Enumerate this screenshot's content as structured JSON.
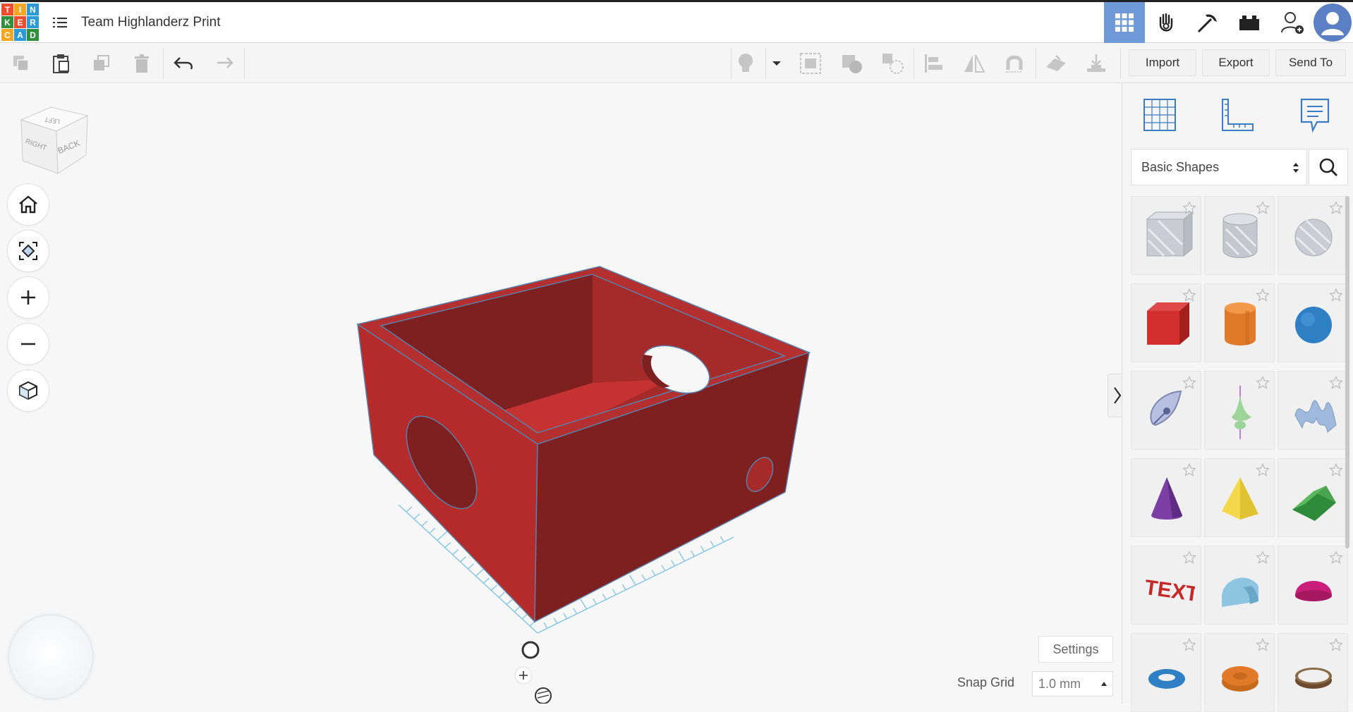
{
  "app": {
    "title": "Team Highlanderz Print",
    "logo_letters": [
      "T",
      "I",
      "N",
      "K",
      "E",
      "R",
      "C",
      "A",
      "D"
    ],
    "logo_colors": [
      "#e94f2e",
      "#f5a623",
      "#2a9bd7",
      "#2f8f3a",
      "#e94f2e",
      "#2a9bd7",
      "#f5a623",
      "#2a9bd7",
      "#2f8f3a"
    ]
  },
  "header_buttons": [
    {
      "name": "3d-design",
      "icon": "grid-view-icon",
      "active": true
    },
    {
      "name": "circuits",
      "icon": "hand-icon"
    },
    {
      "name": "blocks",
      "icon": "pickaxe-icon"
    },
    {
      "name": "bricks",
      "icon": "brick-icon"
    },
    {
      "name": "add-user",
      "icon": "add-user-icon"
    },
    {
      "name": "account",
      "icon": "avatar-icon"
    }
  ],
  "toolbar": {
    "import_label": "Import",
    "export_label": "Export",
    "send_to_label": "Send To"
  },
  "view_cube": {
    "top_label": "LEFT",
    "face_left": "RIGHT",
    "face_right": "BACK"
  },
  "panel": {
    "category": "Basic Shapes",
    "shapes": [
      "Box (hole)",
      "Cylinder (hole)",
      "Sphere (hole)",
      "Box",
      "Cylinder",
      "Sphere",
      "Scribble",
      "Shape Generator",
      "Text Wave",
      "Cone",
      "Pyramid",
      "Roof",
      "Text",
      "Half Cylinder",
      "Half Sphere",
      "Torus",
      "Tube",
      "Ring"
    ]
  },
  "bottom": {
    "settings_label": "Settings",
    "snap_grid_label": "Snap Grid",
    "snap_grid_value": "1.0 mm"
  },
  "colors": {
    "accent": "#6f9ad8",
    "box_red": "#a52a2a",
    "box_dark": "#7e1f20",
    "grid_blue": "#7fc4e8"
  }
}
